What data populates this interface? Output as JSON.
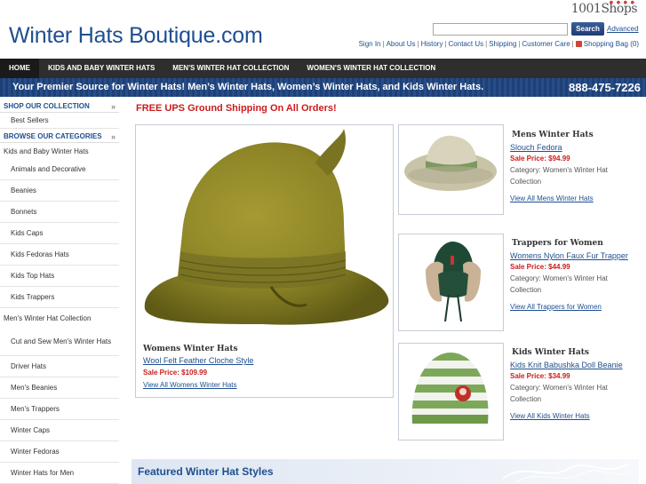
{
  "header": {
    "logo": "Winter Hats Boutique.com",
    "brand": "1001Shops",
    "search_placeholder": "",
    "search_button": "Search",
    "advanced": "Advanced",
    "links": [
      "Sign In",
      "About Us",
      "History",
      "Contact Us",
      "Shipping",
      "Customer Care"
    ],
    "bag": "Shopping Bag (0)"
  },
  "nav": [
    "HOME",
    "KIDS AND BABY WINTER HATS",
    "MEN'S WINTER HAT COLLECTION",
    "WOMEN'S WINTER HAT COLLECTION"
  ],
  "banner": {
    "tagline": "Your Premier Source for Winter Hats! Men’s Winter Hats, Women’s Winter Hats, and Kids Winter Hats.",
    "phone": "888-475-7226"
  },
  "sidebar": {
    "shop_heading": "SHOP OUR COLLECTION",
    "best_sellers": "Best Sellers",
    "browse_heading": "BROWSE OUR CATEGORIES",
    "group1": "Kids and Baby Winter Hats",
    "group1_items": [
      "Animals and Decorative",
      "Beanies",
      "Bonnets",
      "Kids Caps",
      "Kids Fedoras Hats",
      "Kids Top Hats",
      "Kids Trappers"
    ],
    "group2": "Men's Winter Hat Collection",
    "group2_items": [
      "Cut and Sew Men's Winter Hats",
      "Driver Hats",
      "Men's Beanies",
      "Men's Trappers",
      "Winter Caps",
      "Winter Fedoras",
      "Winter Hats for Men"
    ]
  },
  "promo": "FREE UPS Ground Shipping On All Orders!",
  "main_feature": {
    "category": "Womens Winter Hats",
    "product": "Wool Felt Feather Cloche Style",
    "price": "Sale Price: $109.99",
    "view_all": "View All Womens Winter Hats"
  },
  "cards": [
    {
      "category": "Mens Winter Hats",
      "product": "Slouch Fedora",
      "price": "Sale Price: $94.99",
      "meta": "Category: Women's Winter Hat Collection",
      "view_all": "View All Mens Winter Hats"
    },
    {
      "category": "Trappers for Women",
      "product": "Womens Nylon Faux Fur Trapper",
      "price": "Sale Price: $44.99",
      "meta": "Category: Women's Winter Hat Collection",
      "view_all": "View All Trappers for Women"
    },
    {
      "category": "Kids Winter Hats",
      "product": "Kids Knit Babushka Doll Beanie",
      "price": "Sale Price: $34.99",
      "meta": "Category: Women's Winter Hat Collection",
      "view_all": "View All Kids Winter Hats"
    }
  ],
  "featured_heading": "Featured Winter Hat Styles",
  "colors": {
    "brand_blue": "#1f4f8f",
    "nav_bg": "#2e2e2e",
    "banner_bg": "#1d4077",
    "sale_red": "#cc1c1c"
  }
}
